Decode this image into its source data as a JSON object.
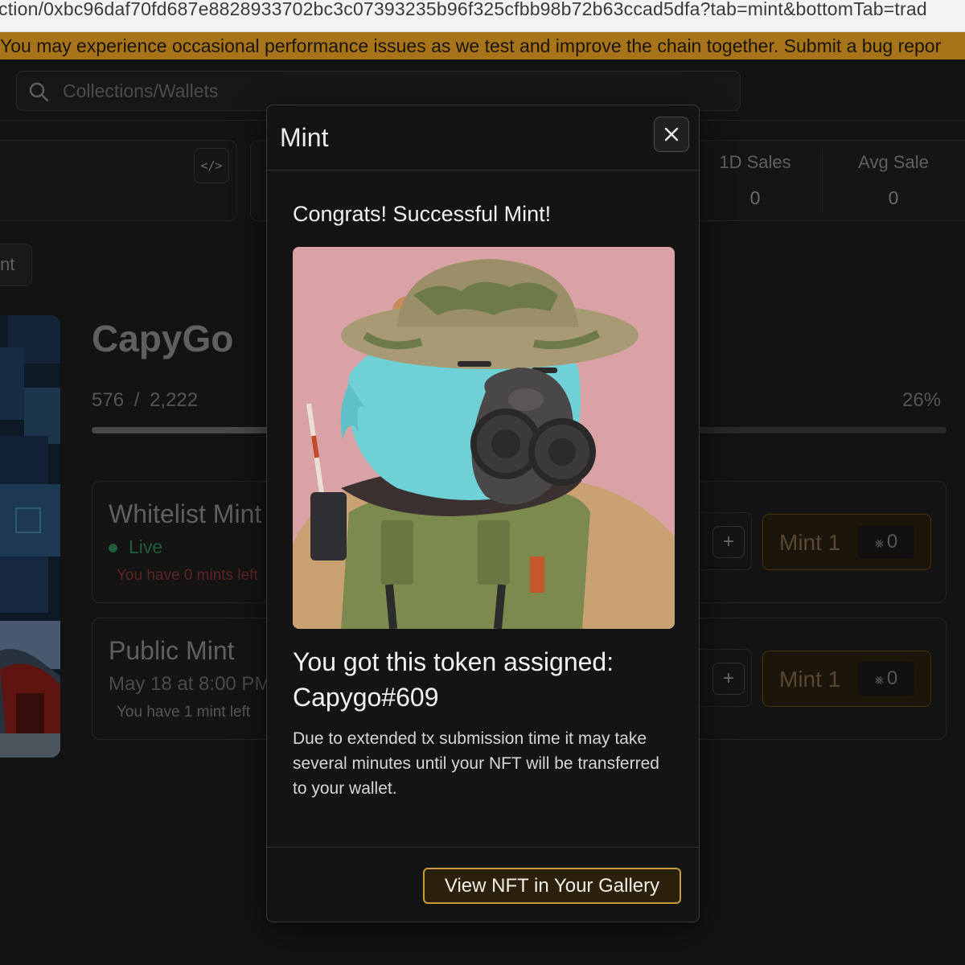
{
  "browser": {
    "url": "ction/0xbc96daf70fd687e8828933702bc3c07393235b96f325cfbb98b72b63ccad5dfa?tab=mint&bottomTab=trad"
  },
  "banner": {
    "text": "You may experience occasional performance issues as we test and improve the chain together. Submit a bug repor"
  },
  "search": {
    "placeholder": "Collections/Wallets",
    "icon": "search-icon"
  },
  "stats": {
    "items": [
      {
        "label": "1D Sales",
        "value": "0"
      },
      {
        "label": "Avg Sale",
        "value": "0"
      }
    ]
  },
  "tabs": {
    "partial_label": "nt"
  },
  "collection": {
    "name": "CapyGo",
    "minted": "576",
    "separator": "/",
    "total": "2,222",
    "percent_label": "26%",
    "progress_fraction": 0.26
  },
  "phases": [
    {
      "name": "Whitelist Mint",
      "status": "Live",
      "mints_left": "You have 0 mints left",
      "mint_label": "Mint 1",
      "price": "0",
      "plus": "+"
    },
    {
      "name": "Public Mint",
      "date": "May 18 at 8:00 PM",
      "mints_left": "You have 1 mint left",
      "mint_label": "Mint 1",
      "price": "0",
      "plus": "+"
    }
  ],
  "modal": {
    "title": "Mint",
    "congrats": "Congrats! Successful Mint!",
    "assigned_text": "You got this token assigned:",
    "token": "Capygo#609",
    "note": "Due to extended tx submission time it may take several minutes until your NFT will be transferred to your wallet.",
    "cta": "View NFT in Your Gallery"
  },
  "colors": {
    "accent": "#c99a3a",
    "banner": "#a87419",
    "live": "#2e8a55",
    "warning": "#8a3636",
    "modal_bg": "#141414"
  }
}
